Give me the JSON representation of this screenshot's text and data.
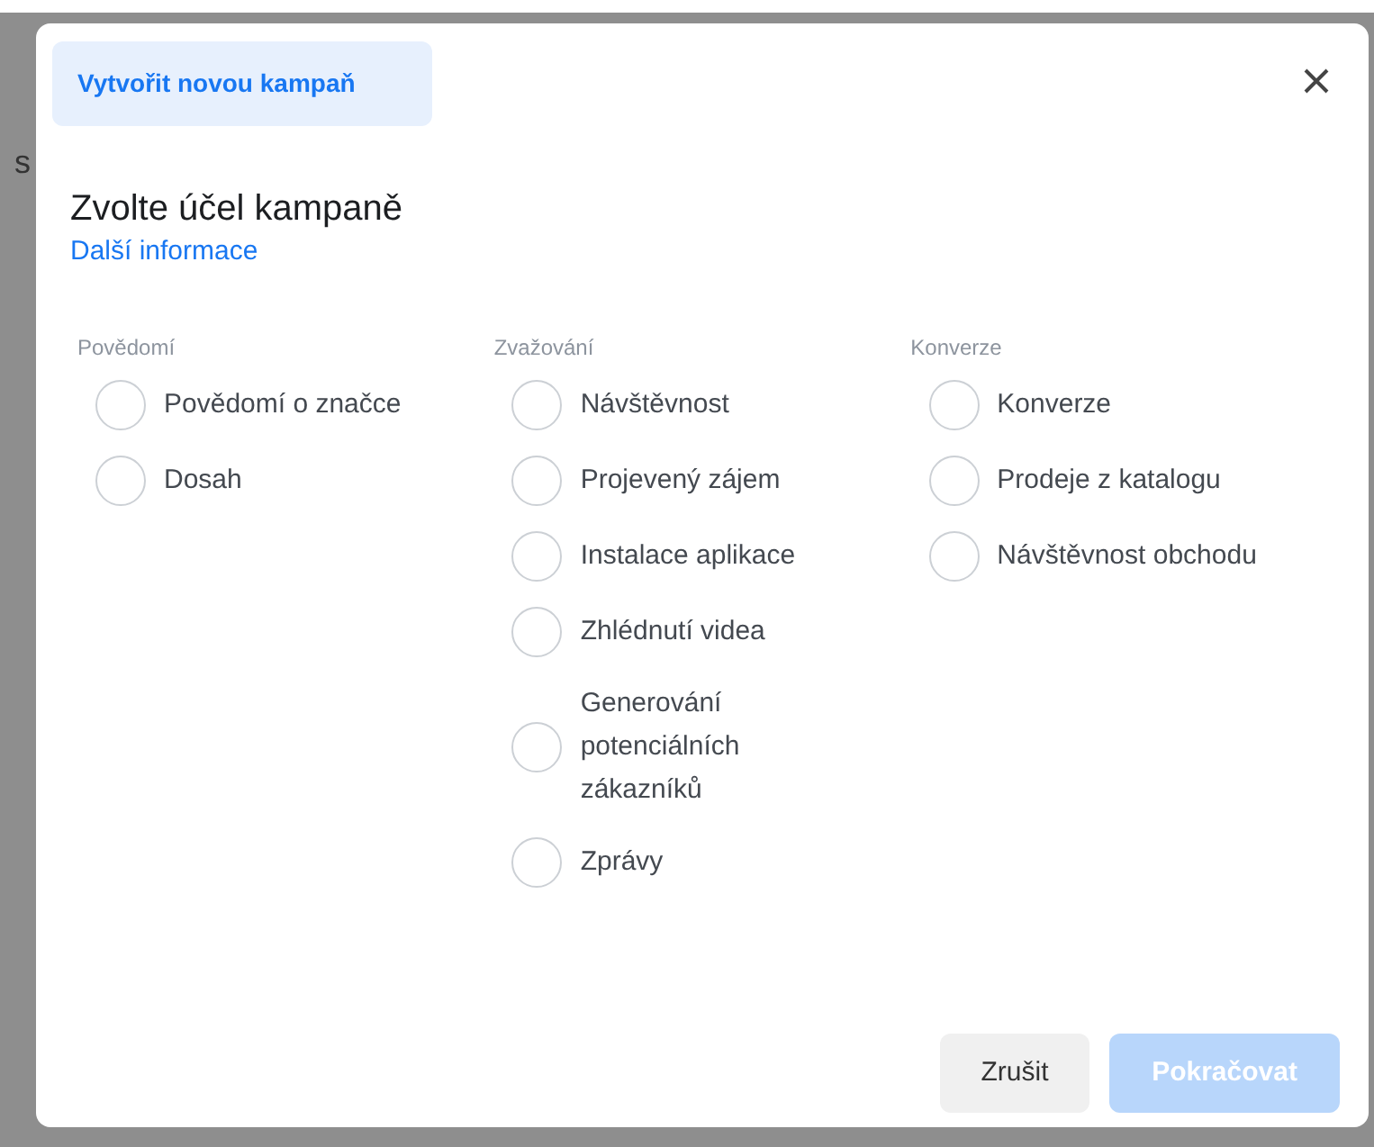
{
  "background": {
    "text": "s"
  },
  "dialog": {
    "title_tab": "Vytvořit novou kampaň",
    "heading": "Zvolte účel kampaně",
    "link": "Další informace",
    "columns": [
      {
        "label": "Povědomí",
        "options": [
          {
            "label": "Povědomí o značce",
            "selected": false
          },
          {
            "label": "Dosah",
            "selected": false
          }
        ]
      },
      {
        "label": "Zvažování",
        "options": [
          {
            "label": "Návštěvnost",
            "selected": false
          },
          {
            "label": "Projevený zájem",
            "selected": false
          },
          {
            "label": "Instalace aplikace",
            "selected": false
          },
          {
            "label": "Zhlédnutí videa",
            "selected": false
          },
          {
            "label": "Generování potenciálních zákazníků",
            "selected": false
          },
          {
            "label": "Zprávy",
            "selected": false
          }
        ]
      },
      {
        "label": "Konverze",
        "options": [
          {
            "label": "Konverze",
            "selected": false
          },
          {
            "label": "Prodeje z katalogu",
            "selected": false
          },
          {
            "label": "Návštěvnost obchodu",
            "selected": false
          }
        ]
      }
    ],
    "buttons": [
      {
        "label": "Zrušit",
        "kind": "secondary",
        "disabled": false
      },
      {
        "label": "Pokračovat",
        "kind": "primary",
        "disabled": true
      }
    ]
  }
}
